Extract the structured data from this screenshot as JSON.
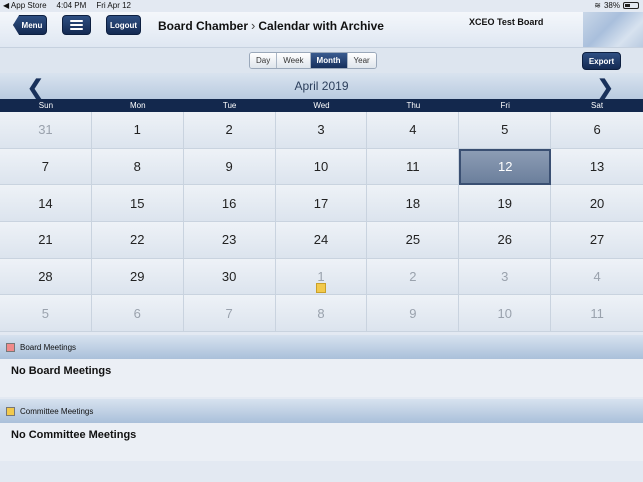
{
  "status_bar": {
    "back_app": "◀ App Store",
    "time": "4:04 PM",
    "date": "Fri Apr 12",
    "battery": "38%"
  },
  "header": {
    "menu_label": "Menu",
    "logout_label": "Logout",
    "breadcrumb_parent": "Board Chamber",
    "breadcrumb_current": "Calendar with Archive",
    "board_name": "XCEO Test Board"
  },
  "toolbar": {
    "views": [
      "Day",
      "Week",
      "Month",
      "Year"
    ],
    "active_view": "Month",
    "export_label": "Export"
  },
  "calendar": {
    "month_title": "April 2019",
    "weekdays": [
      "Sun",
      "Mon",
      "Tue",
      "Wed",
      "Thu",
      "Fri",
      "Sat"
    ],
    "days": [
      {
        "d": "31",
        "muted": true
      },
      {
        "d": "1"
      },
      {
        "d": "2"
      },
      {
        "d": "3"
      },
      {
        "d": "4"
      },
      {
        "d": "5"
      },
      {
        "d": "6"
      },
      {
        "d": "7"
      },
      {
        "d": "8"
      },
      {
        "d": "9"
      },
      {
        "d": "10"
      },
      {
        "d": "11"
      },
      {
        "d": "12",
        "today": true
      },
      {
        "d": "13"
      },
      {
        "d": "14"
      },
      {
        "d": "15"
      },
      {
        "d": "16"
      },
      {
        "d": "17"
      },
      {
        "d": "18"
      },
      {
        "d": "19"
      },
      {
        "d": "20"
      },
      {
        "d": "21"
      },
      {
        "d": "22"
      },
      {
        "d": "23"
      },
      {
        "d": "24"
      },
      {
        "d": "25"
      },
      {
        "d": "26"
      },
      {
        "d": "27"
      },
      {
        "d": "28"
      },
      {
        "d": "29"
      },
      {
        "d": "30"
      },
      {
        "d": "1",
        "muted": true,
        "marker": true
      },
      {
        "d": "2",
        "muted": true
      },
      {
        "d": "3",
        "muted": true
      },
      {
        "d": "4",
        "muted": true
      },
      {
        "d": "5",
        "muted": true
      },
      {
        "d": "6",
        "muted": true
      },
      {
        "d": "7",
        "muted": true
      },
      {
        "d": "8",
        "muted": true
      },
      {
        "d": "9",
        "muted": true
      },
      {
        "d": "10",
        "muted": true
      },
      {
        "d": "11",
        "muted": true
      }
    ]
  },
  "board_meetings": {
    "title": "Board Meetings",
    "color": "#f08a8a",
    "empty_text": "No Board Meetings"
  },
  "committee_meetings": {
    "title": "Committee Meetings",
    "color": "#f2c94c",
    "empty_text": "No Committee Meetings"
  }
}
